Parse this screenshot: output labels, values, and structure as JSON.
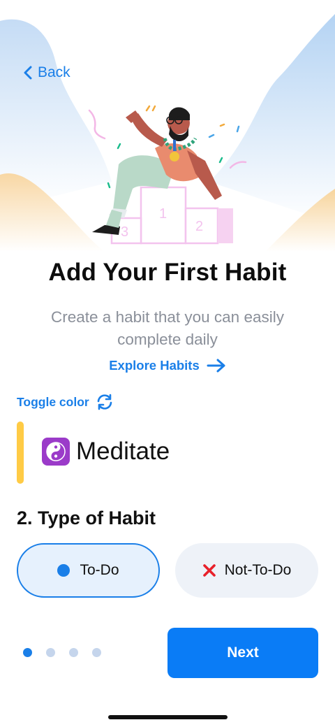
{
  "nav": {
    "back_label": "Back"
  },
  "hero": {
    "podium_labels": [
      "3",
      "1",
      "2"
    ]
  },
  "title": "Add Your First Habit",
  "subtitle": "Create a habit that you can easily complete daily",
  "explore_label": "Explore Habits",
  "toggle_color_label": "Toggle color",
  "habit": {
    "icon": "yin-yang",
    "name": "Meditate",
    "accent_color": "#ffcb45"
  },
  "type_section": {
    "heading": "2. Type of Habit",
    "options": [
      {
        "label": "To-Do",
        "selected": true
      },
      {
        "label": "Not-To-Do",
        "selected": false
      }
    ]
  },
  "pager": {
    "total": 4,
    "current": 1
  },
  "next_label": "Next",
  "colors": {
    "accent": "#1a7fe8",
    "primary_button": "#0a7cf6"
  }
}
